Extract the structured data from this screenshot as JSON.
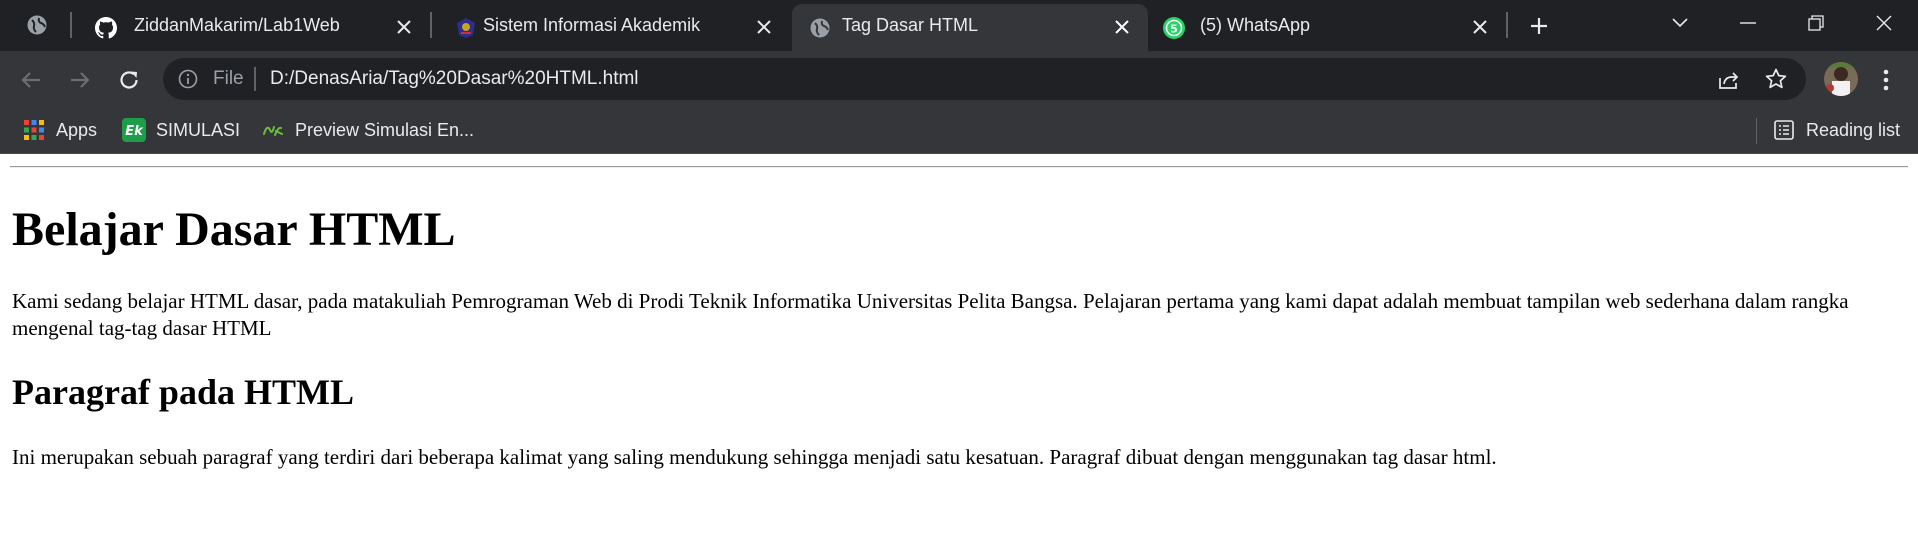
{
  "tabs": [
    {
      "title": "ZiddanMakarim/Lab1Web",
      "favicon": "github-icon",
      "active": false
    },
    {
      "title": "Sistem Informasi Akademik",
      "favicon": "university-logo-icon",
      "active": false
    },
    {
      "title": "Tag Dasar HTML",
      "favicon": "globe-icon",
      "active": true
    },
    {
      "title": "(5) WhatsApp",
      "favicon": "whatsapp-icon",
      "badge": "5",
      "active": false
    }
  ],
  "toolbar": {
    "file_label": "File",
    "url": "D:/DenasAria/Tag%20Dasar%20HTML.html"
  },
  "bookmarks": {
    "items": [
      {
        "label": "Apps",
        "icon": "apps-grid-icon"
      },
      {
        "label": "SIMULASI",
        "icon": "ek-logo-icon"
      },
      {
        "label": "Preview Simulasi En...",
        "icon": "ek-script-icon"
      }
    ],
    "reading_list": "Reading list"
  },
  "content": {
    "heading": "Belajar Dasar HTML",
    "intro": "Kami sedang belajar HTML dasar, pada matakuliah Pemrograman Web di Prodi Teknik Informatika Universitas Pelita Bangsa. Pelajaran pertama yang kami dapat adalah membuat tampilan web sederhana dalam rangka mengenal tag-tag dasar HTML",
    "subheading": "Paragraf pada HTML",
    "paragraph": "Ini merupakan sebuah paragraf yang terdiri dari beberapa kalimat yang saling mendukung sehingga menjadi satu kesatuan. Paragraf dibuat dengan menggunakan tag dasar html."
  },
  "colors": {
    "tabstrip": "#202124",
    "toolbar": "#35363a",
    "text_light": "#e8eaed",
    "whatsapp": "#25d366"
  }
}
